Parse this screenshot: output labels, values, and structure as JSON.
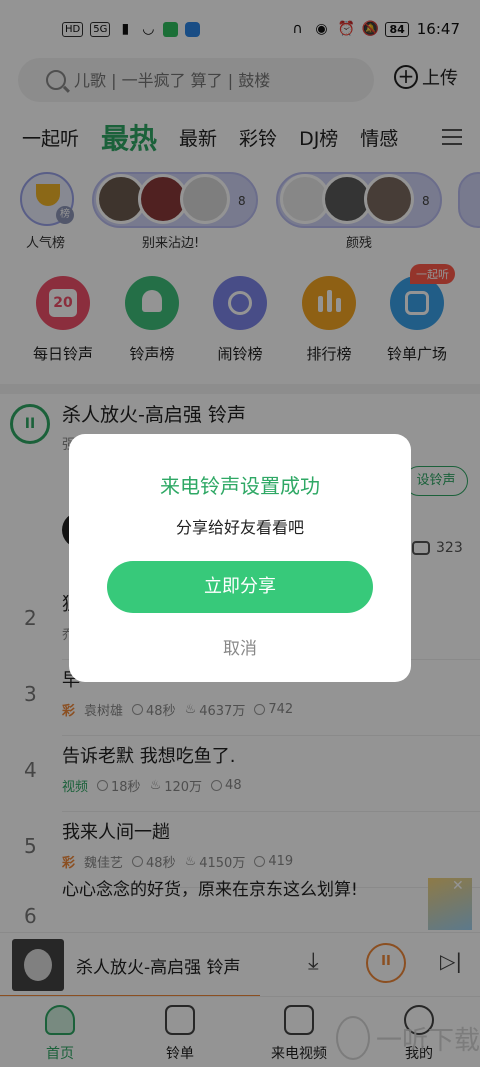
{
  "status_bar": {
    "left_chips": [
      "HD",
      "5G"
    ],
    "battery": "84",
    "time": "16:47"
  },
  "search": {
    "placeholder": "儿歌 | 一半疯了 算了 | 鼓楼"
  },
  "upload_label": "上传",
  "tabs": [
    "一起听",
    "最热",
    "最新",
    "彩铃",
    "DJ榜",
    "情感"
  ],
  "active_tab": "最热",
  "charts": [
    {
      "label": "人气榜",
      "badge": "榜"
    },
    {
      "label": "别来沾边!",
      "count": "8"
    },
    {
      "label": "颜残",
      "count": "8"
    }
  ],
  "functions": [
    {
      "label": "每日铃声",
      "icon": "calendar-icon",
      "color": "#f0506a",
      "day": "20"
    },
    {
      "label": "铃声榜",
      "icon": "bell-icon",
      "color": "#3fc07a"
    },
    {
      "label": "闹铃榜",
      "icon": "alarm-icon",
      "color": "#7c86e8"
    },
    {
      "label": "排行榜",
      "icon": "bars-icon",
      "color": "#f5a623"
    },
    {
      "label": "铃单广场",
      "icon": "list-icon",
      "color": "#3aa0e8"
    }
  ],
  "func_badge": "一起听",
  "now_song": {
    "title": "杀人放火-高启强 铃声",
    "set_button": "设铃声",
    "comments": "323",
    "sub_fragment": "强"
  },
  "songs": [
    {
      "rank": "2",
      "title": "独",
      "tag": "",
      "artist": "乔",
      "duration": "",
      "plays": "",
      "comments": ""
    },
    {
      "rank": "3",
      "title": "早",
      "tag": "彩",
      "artist": "袁树雄",
      "duration": "48秒",
      "plays": "4637万",
      "comments": "742"
    },
    {
      "rank": "4",
      "title": "告诉老默 我想吃鱼了.",
      "tag": "视频",
      "artist": "",
      "duration": "18秒",
      "plays": "120万",
      "comments": "48"
    },
    {
      "rank": "5",
      "title": "我来人间一趟",
      "tag": "彩",
      "artist": "魏佳艺",
      "duration": "48秒",
      "plays": "4150万",
      "comments": "419"
    }
  ],
  "ad": {
    "rank": "6",
    "title": "心心念念的好货，原来在京东这么划算!"
  },
  "player": {
    "title": "杀人放火-高启强 铃声"
  },
  "bottom_nav": [
    "首页",
    "铃单",
    "来电视频",
    "我的"
  ],
  "dialog": {
    "title": "来电铃声设置成功",
    "message": "分享给好友看看吧",
    "share_button": "立即分享",
    "cancel_button": "取消"
  },
  "watermark": "一听下载",
  "colors": {
    "accent": "#2fa865",
    "share_button": "#37c97a",
    "orange": "#f0883a",
    "overlay": "rgba(0,0,0,0.42)"
  }
}
